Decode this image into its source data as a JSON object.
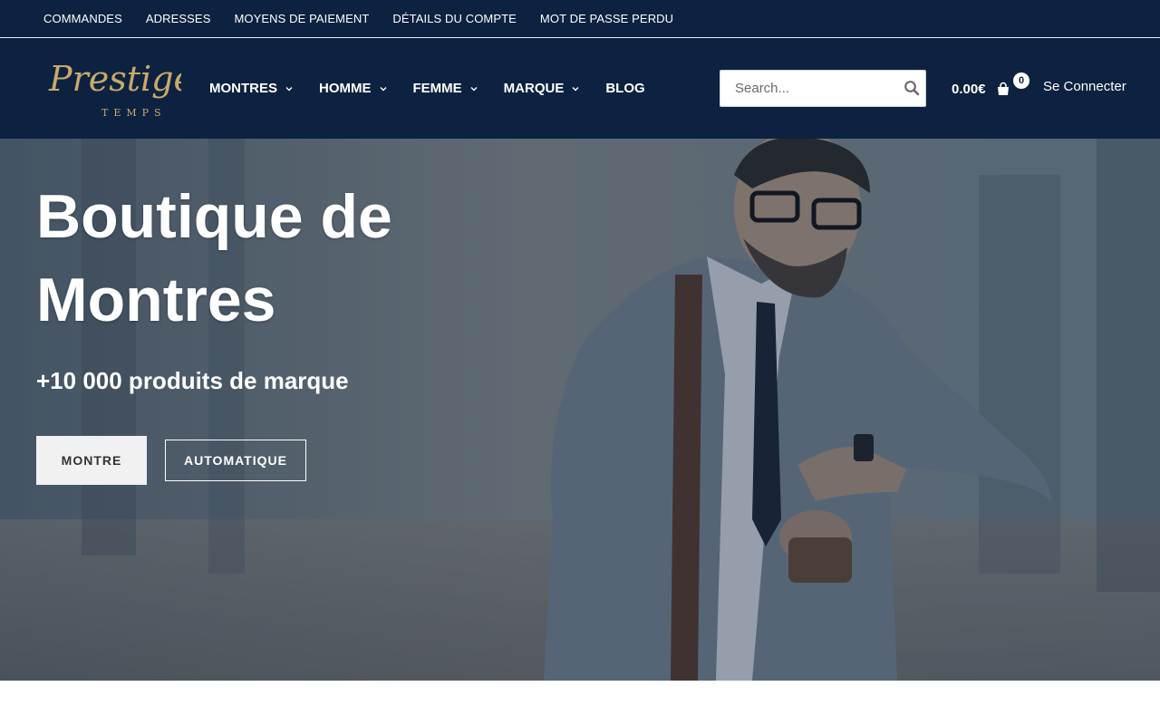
{
  "topbar": {
    "links": [
      "COMMANDES",
      "ADRESSES",
      "MOYENS DE PAIEMENT",
      "DÉTAILS DU COMPTE",
      "MOT DE PASSE PERDU"
    ]
  },
  "header": {
    "logo": {
      "script_text": "Prestige",
      "sub_text": "TEMPS"
    },
    "nav": [
      {
        "label": "MONTRES",
        "has_dropdown": true
      },
      {
        "label": "HOMME",
        "has_dropdown": true
      },
      {
        "label": "FEMME",
        "has_dropdown": true
      },
      {
        "label": "MARQUE",
        "has_dropdown": true
      },
      {
        "label": "BLOG",
        "has_dropdown": false
      }
    ],
    "search": {
      "placeholder": "Search...",
      "value": "",
      "icon": "search-icon"
    },
    "cart": {
      "total": "0.00€",
      "count": "0",
      "icon": "shopping-bag-icon"
    },
    "login_label": "Se Connecter"
  },
  "hero": {
    "title": "Boutique de Montres",
    "subtitle": "+10 000 produits de marque",
    "primary_button": "MONTRE",
    "secondary_button": "AUTOMATIQUE"
  },
  "colors": {
    "header_bg": "#0d2240",
    "logo_gold": "#c9a96a",
    "button_light": "#f1f1f1"
  }
}
